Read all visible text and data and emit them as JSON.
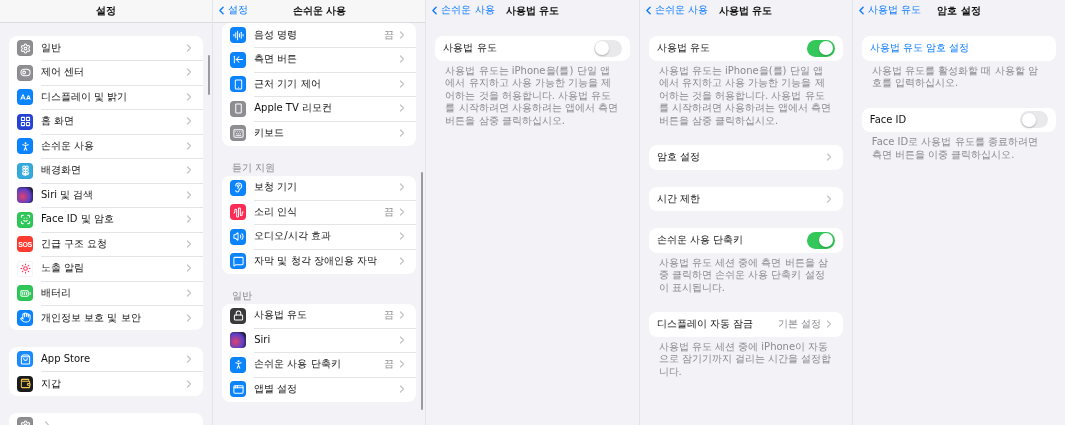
{
  "panes": [
    {
      "title": "설정",
      "scrolled": false,
      "sections": [
        {
          "rows": [
            {
              "kind": "nav",
              "label": "일반"
            },
            {
              "kind": "nav",
              "label": "제어 센터"
            },
            {
              "kind": "nav",
              "label": "디스플레이 및 밝기"
            },
            {
              "kind": "nav",
              "label": "홈 화면"
            },
            {
              "kind": "nav",
              "label": "손쉬운 사용"
            },
            {
              "kind": "nav",
              "label": "배경화면"
            },
            {
              "kind": "nav",
              "label": "Siri 및 검색"
            },
            {
              "kind": "nav",
              "label": "Face ID 및 암호"
            },
            {
              "kind": "nav",
              "icon_text": "SOS",
              "label": "긴급 구조 요청"
            },
            {
              "kind": "nav",
              "label": "노출 알림"
            },
            {
              "kind": "nav",
              "label": "배터리"
            },
            {
              "kind": "nav",
              "label": "개인정보 보호 및 보안"
            }
          ]
        },
        {
          "rows": [
            {
              "kind": "nav",
              "label": "App Store"
            },
            {
              "kind": "nav",
              "label": "지갑"
            }
          ]
        },
        {
          "rows": [
            {
              "kind": "nav"
            }
          ]
        }
      ]
    },
    {
      "title": "손쉬운 사용",
      "back": "설정",
      "scrolled": true,
      "sections": [
        {
          "rows": [
            {
              "kind": "nav",
              "label": "음성 명령",
              "value": "끔"
            },
            {
              "kind": "nav",
              "label": "측면 버튼"
            },
            {
              "kind": "nav",
              "label": "근처 기기 제어"
            },
            {
              "kind": "nav",
              "label": "Apple TV 리모컨"
            },
            {
              "kind": "nav",
              "label": "키보드"
            }
          ]
        },
        {
          "header": "듣기 지원",
          "rows": [
            {
              "kind": "nav",
              "label": "보청 기기"
            },
            {
              "kind": "nav",
              "label": "소리 인식",
              "value": "끔"
            },
            {
              "kind": "nav",
              "label": "오디오/시각 효과"
            },
            {
              "kind": "nav",
              "label": "자막 및 청각 장애인용 자막"
            }
          ]
        },
        {
          "header": "일반",
          "rows": [
            {
              "kind": "nav",
              "label": "사용법 유도",
              "value": "끔"
            },
            {
              "kind": "nav",
              "label": "Siri"
            },
            {
              "kind": "nav",
              "label": "손쉬운 사용 단축키",
              "value": "끔"
            },
            {
              "kind": "nav",
              "label": "앱별 설정"
            }
          ]
        }
      ]
    },
    {
      "title": "사용법 유도",
      "back": "손쉬운 사용",
      "scrolled": false,
      "sections": [
        {
          "rows": [
            {
              "kind": "toggle",
              "label": "사용법 유도",
              "on": false
            }
          ],
          "footer": "사용법 유도는 iPhone을(를) 단일 앱에서 유지하고 사용 가능한 기능을 제어하는 것을 허용합니다. 사용법 유도를 시작하려면 사용하려는 앱에서 측면 버튼을 삼중 클릭하십시오."
        }
      ]
    },
    {
      "title": "사용법 유도",
      "back": "손쉬운 사용",
      "scrolled": false,
      "sections": [
        {
          "rows": [
            {
              "kind": "toggle",
              "label": "사용법 유도",
              "on": true
            }
          ],
          "footer": "사용법 유도는 iPhone을(를) 단일 앱에서 유지하고 사용 가능한 기능을 제어하는 것을 허용합니다. 사용법 유도를 시작하려면 사용하려는 앱에서 측면 버튼을 삼중 클릭하십시오."
        },
        {
          "rows": [
            {
              "kind": "nav",
              "label": "암호 설정"
            }
          ]
        },
        {
          "rows": [
            {
              "kind": "nav",
              "label": "시간 제한"
            }
          ]
        },
        {
          "rows": [
            {
              "kind": "toggle",
              "label": "손쉬운 사용 단축키",
              "on": true
            }
          ],
          "footer": "사용법 유도 세션 중에 측면 버튼을 삼중 클릭하면 손쉬운 사용 단축키 설정이 표시됩니다."
        },
        {
          "rows": [
            {
              "kind": "nav",
              "label": "디스플레이 자동 잠금",
              "value": "기본 설정"
            }
          ],
          "footer": "사용법 유도 세션 중에 iPhone이 자동으로 잠기기까지 걸리는 시간을 설정합니다."
        }
      ]
    },
    {
      "title": "암호 설정",
      "back": "사용법 유도",
      "scrolled": false,
      "sections": [
        {
          "rows": [
            {
              "kind": "link",
              "label": "사용법 유도 암호 설정"
            }
          ],
          "footer": "사용법 유도를 활성화할 때 사용할 암호를 입력하십시오."
        },
        {
          "rows": [
            {
              "kind": "toggle",
              "label": "Face ID",
              "on": false
            }
          ],
          "footer": "Face ID로 사용법 유도를 종료하려면 측면 버튼을 이중 클릭하십시오."
        }
      ]
    }
  ]
}
